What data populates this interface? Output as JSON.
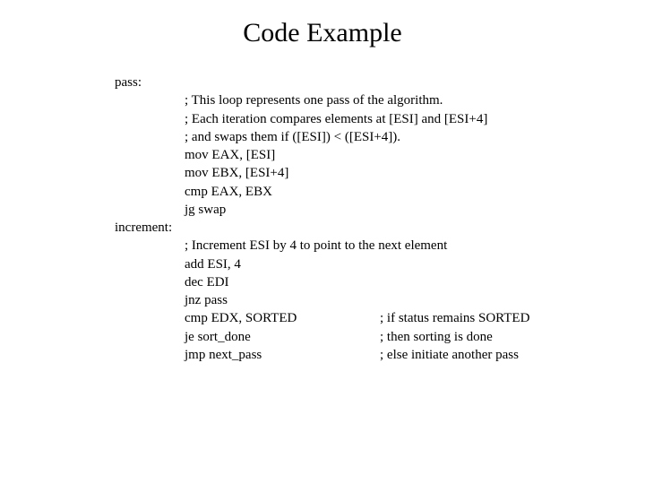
{
  "title": "Code Example",
  "code": {
    "label1": "pass:",
    "c1": "; This loop represents one pass of the algorithm.",
    "c2": "; Each iteration compares elements at [ESI] and [ESI+4]",
    "c3": "; and swaps them if ([ESI]) < ([ESI+4]).",
    "i1": "mov EAX, [ESI]",
    "i2": "mov EBX, [ESI+4]",
    "i3": "cmp EAX, EBX",
    "i4": "jg swap",
    "label2": "increment:",
    "c4": "; Increment ESI by 4 to point to the next element",
    "i5": "add ESI, 4",
    "i6": "dec EDI",
    "i7": "jnz pass",
    "i8": "cmp EDX, SORTED",
    "c5": "; if status remains SORTED",
    "i9": "je sort_done",
    "c6": "; then sorting is done",
    "i10": "jmp next_pass",
    "c7": "; else initiate another pass"
  }
}
